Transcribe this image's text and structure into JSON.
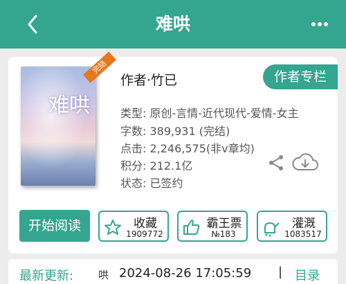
{
  "header": {
    "title": "难哄",
    "back_icon": "chevron-left-icon",
    "more_icon": "more-dots-icon"
  },
  "book": {
    "cover": {
      "ribbon": "完结",
      "calligraphy": "难哄"
    },
    "author_label": "作者·竹已",
    "author_button": "作者专栏",
    "info": {
      "type": "类型: 原创-言情-近代现代-爱情-女主",
      "words": "字数: 389,931 (完结)",
      "clicks": "点击: 2,246,575(非v章均)",
      "points": "积分: 212.1亿",
      "status": "状态: 已签约"
    }
  },
  "actions": {
    "start_reading": "开始阅读",
    "favorite": {
      "label": "收藏",
      "count": "1909772",
      "icon": "star-icon"
    },
    "vote": {
      "label": "霸王票",
      "count": "№183",
      "icon": "thumbs-up-icon"
    },
    "water": {
      "label": "灌溉",
      "count": "1083517",
      "icon": "watering-can-icon"
    }
  },
  "update": {
    "label": "最新更新:",
    "chapter": "哄",
    "time": "2024-08-26 17:05:59",
    "separator": "|",
    "toc": "目录"
  },
  "colors": {
    "accent": "#34a58f",
    "ribbon": "#e8761e"
  }
}
